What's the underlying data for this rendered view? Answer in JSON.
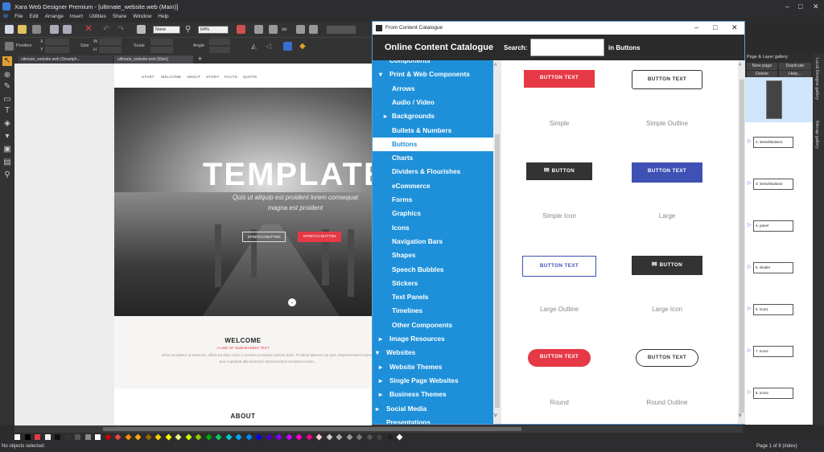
{
  "app": {
    "title": "Xara Web Designer Premium - [ultimate_website.web (Main)]",
    "menu": [
      "File",
      "Edit",
      "Arrange",
      "Insert",
      "Utilities",
      "Share",
      "Window",
      "Help"
    ]
  },
  "toolbar": {
    "fill_value": "None",
    "zoom_value": "64%",
    "position_label": "Position",
    "x_label": "X",
    "y_label": "Y",
    "size_label": "Size",
    "w_label": "W",
    "h_label": "H",
    "scale_label": "Scale",
    "angle_label": "Angle"
  },
  "tabs": [
    {
      "label": "ultimate_website.web [Smartph..."
    },
    {
      "label": "ultimate_website.web [Main]"
    }
  ],
  "website": {
    "nav": [
      "START",
      "WELCOME",
      "ABOUT",
      "STORY",
      "FACTS",
      "QUOTE"
    ],
    "hero_title": "TEMPLATE",
    "hero_subtitle": "Quis ut aliquip est proident lorem consequat magna est proident",
    "button1": "STRETCH BUTTON",
    "button2": "STRETCH BUTTON",
    "welcome_heading": "WELCOME",
    "welcome_sub": "A LINE OF SUBHEADING TEXT",
    "welcome_body": "Enim excepteur ut euismod, officia ad dolor enim in veniam excepteur laboris dolor. Proident laborum ea quis. Reprehenderit nostrud quis cupidatat alla eiusmod, reprehenderit excepteur lorem...",
    "about_heading": "ABOUT"
  },
  "dialog": {
    "window_title": "From Content Catalogue",
    "heading": "Online Content Catalogue",
    "search_label": "Search:",
    "search_value": "",
    "in_label": "in Buttons",
    "tree": [
      {
        "label": "Components",
        "level": 1,
        "arrow": ""
      },
      {
        "label": "Print & Web Components",
        "level": 1,
        "arrow": "▾"
      },
      {
        "label": "Arrows",
        "level": 2,
        "arrow": ""
      },
      {
        "label": "Audio / Video",
        "level": 2,
        "arrow": ""
      },
      {
        "label": "Backgrounds",
        "level": 2,
        "arrow": "▸"
      },
      {
        "label": "Bullets & Numbers",
        "level": 2,
        "arrow": ""
      },
      {
        "label": "Buttons",
        "level": 2,
        "arrow": "",
        "selected": true
      },
      {
        "label": "Charts",
        "level": 2,
        "arrow": ""
      },
      {
        "label": "Dividers & Flourishes",
        "level": 2,
        "arrow": ""
      },
      {
        "label": "eCommerce",
        "level": 2,
        "arrow": ""
      },
      {
        "label": "Forms",
        "level": 2,
        "arrow": ""
      },
      {
        "label": "Graphics",
        "level": 2,
        "arrow": ""
      },
      {
        "label": "Icons",
        "level": 2,
        "arrow": ""
      },
      {
        "label": "Navigation Bars",
        "level": 2,
        "arrow": ""
      },
      {
        "label": "Shapes",
        "level": 2,
        "arrow": ""
      },
      {
        "label": "Speech Bubbles",
        "level": 2,
        "arrow": ""
      },
      {
        "label": "Stickers",
        "level": 2,
        "arrow": ""
      },
      {
        "label": "Text Panels",
        "level": 2,
        "arrow": ""
      },
      {
        "label": "Timelines",
        "level": 2,
        "arrow": ""
      },
      {
        "label": "Other Components",
        "level": 2,
        "arrow": ""
      },
      {
        "label": "Image Resources",
        "level": 1,
        "arrow": "▸"
      },
      {
        "label": "Websites",
        "level": 0,
        "arrow": "▾"
      },
      {
        "label": "Website Themes",
        "level": 1,
        "arrow": "▸"
      },
      {
        "label": "Single Page Websites",
        "level": 1,
        "arrow": "▸"
      },
      {
        "label": "Business Themes",
        "level": 1,
        "arrow": "▸"
      },
      {
        "label": "Social Media",
        "level": 0,
        "arrow": "▸"
      },
      {
        "label": "Presentations",
        "level": 0,
        "arrow": ""
      }
    ],
    "items": [
      {
        "button_text": "BUTTON TEXT",
        "label": "Simple",
        "style": "red-rect"
      },
      {
        "button_text": "BUTTON TEXT",
        "label": "Simple Outline",
        "style": "outline-rounded"
      },
      {
        "button_text": "BUTTON",
        "label": "Simple Icon",
        "style": "dark-icon"
      },
      {
        "button_text": "BUTTON TEXT",
        "label": "Large",
        "style": "blue-rect"
      },
      {
        "button_text": "BUTTON TEXT",
        "label": "Large Outline",
        "style": "blue-outline"
      },
      {
        "button_text": "BUTTON",
        "label": "Large Icon",
        "style": "dark-icon-large"
      },
      {
        "button_text": "BUTTON TEXT",
        "label": "Round",
        "style": "red-pill"
      },
      {
        "button_text": "BUTTON TEXT",
        "label": "Round Outline",
        "style": "outline-pill"
      }
    ]
  },
  "gallery": {
    "title": "Page & Layer gallery",
    "buttons": [
      "New page",
      "Duplicate",
      "Delete",
      "Help..."
    ],
    "pages": [
      "2. stretchbutton1",
      "3. stretchbutton2",
      "4. panel",
      "5. divider",
      "6. icon1",
      "7. icon2",
      "8. icon3"
    ],
    "side_tabs": [
      "Local Designs gallery",
      "Bitmap gallery"
    ]
  },
  "status": {
    "left": "No objects selected:",
    "right": "Page 1 of 8 (index)"
  },
  "colors": {
    "accent_blue": "#1e90d9",
    "button_red": "#e53945",
    "button_blue": "#3f51b5",
    "button_dark": "#333333"
  }
}
